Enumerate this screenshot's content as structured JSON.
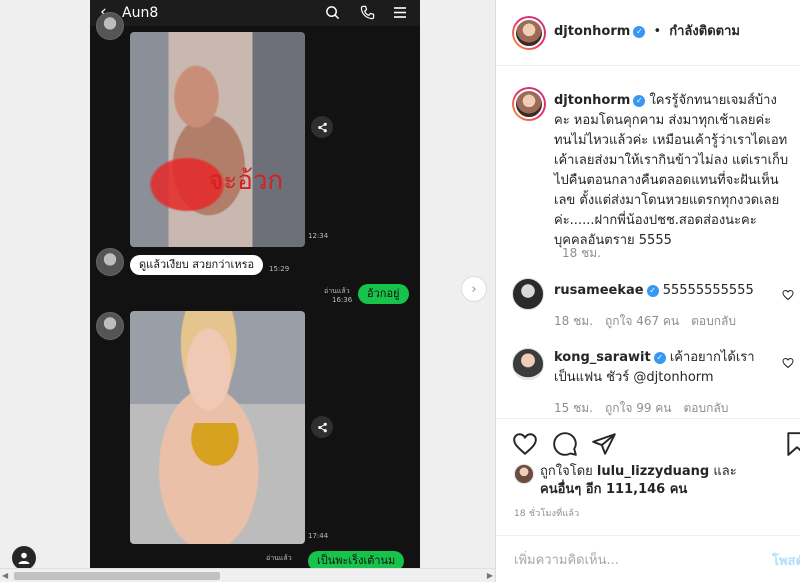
{
  "chat": {
    "title": "Aun8",
    "photo1_time": "12:34",
    "photo1_handwriting": "จะอ้วก",
    "incoming_message": "ดูแล้วเงียบ สวยกว่าเหรอ",
    "incoming_time": "15:29",
    "read_label_1": "อ่านแล้ว",
    "outgoing_time": "16:36",
    "outgoing_message": "อ้วกอยู่",
    "photo2_time": "17:44",
    "read_label_2": "อ่านแล้ว",
    "outgoing_partial": "เป็นพะเร็งเต้านม"
  },
  "post": {
    "owner": "djtonhorm",
    "follow_state": "กำลังติดตาม",
    "separator": "•",
    "caption_user": "djtonhorm",
    "caption_text": "ใครรู้จักทนายเจมส์บ้างคะ หอมโดนคุกคาม ส่งมาทุกเช้าเลยค่ะ ทนไม่ไหวแล้วค่ะ เหมือนเค้ารู้ว่าเราไดเอท เค้าเลยส่งมาให้เรากินข้าวไม่ลง แต่เราเก็บไปคืนตอนกลางคืนตลอดแทนที่จะฝันเห็นเลข ตั้งแต่ส่งมาโดนหวยแดรกทุกงวดเลยค่ะ......ฝากพี่น้องปชช.สอดส่องนะคะ บุคคลอันตราย 5555",
    "caption_time": "18 ชม.",
    "comments": [
      {
        "user": "rusameekae",
        "text": "55555555555",
        "time": "18 ชม.",
        "likes": "ถูกใจ 467 คน",
        "reply": "ตอบกลับ"
      },
      {
        "user": "kong_sarawit",
        "text": "เค้าอยากได้เราเป็นแฟน ชัวร์ @djtonhorm",
        "time": "15 ชม.",
        "likes": "ถูกใจ 99 คน",
        "reply": "ตอบกลับ"
      }
    ],
    "liked_by_prefix": "ถูกใจโดย",
    "liked_by_user": "lulu_lizzyduang",
    "liked_by_and": "และ",
    "liked_by_others": "คนอื่นๆ อีก 111,146 คน",
    "post_time": "18 ชั่วโมงที่แล้ว",
    "comment_placeholder": "เพิ่มความคิดเห็น...",
    "post_button": "โพสต์"
  },
  "colors": {
    "verified": "#3897f0",
    "line_green": "#17c34a",
    "handwriting_red": "#d42020",
    "post_button_disabled": "#b2dffc"
  },
  "icons": [
    "back-icon",
    "search-icon",
    "phone-icon",
    "menu-icon",
    "share-icon",
    "chevron-right-icon",
    "heart-icon",
    "comment-icon",
    "send-icon",
    "bookmark-icon",
    "verified-icon"
  ]
}
